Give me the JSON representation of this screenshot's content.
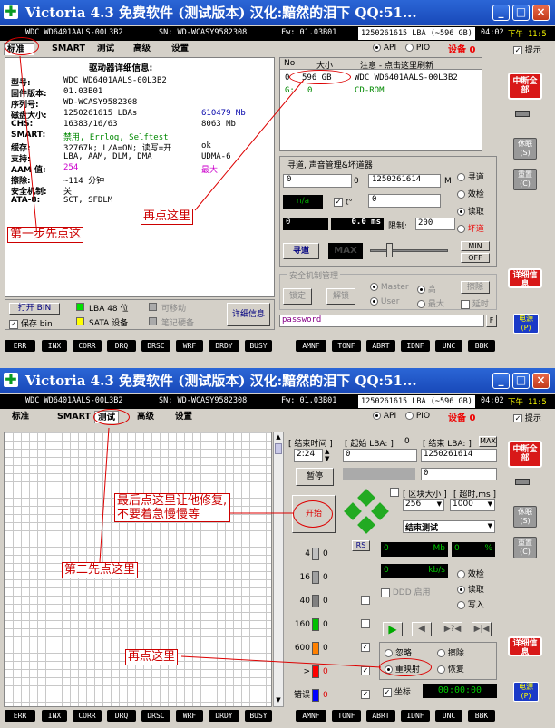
{
  "top": {
    "title": "Victoria 4.3 免费软件 (测试版本) 汉化:黯然的泪下 QQ:51...",
    "drive": "WDC WD6401AALS-00L3B2",
    "sn": "SN: WD-WCASY9582308",
    "fw": "Fw: 01.03B01",
    "lba": "1250261615 LBA (~596 GB)",
    "time1": "04:02",
    "time2": "下午 11:5",
    "tabs": [
      "标准",
      "SMART",
      "测试",
      "高级",
      "设置"
    ],
    "api": "API",
    "pio": "PIO",
    "device_label": "设备",
    "device_num": "0",
    "hint": "提示",
    "info_title": "驱动器详细信息:",
    "info_rows": [
      {
        "label": "型号:",
        "value": "WDC WD6401AALS-00L3B2",
        "extra": ""
      },
      {
        "label": "固件版本:",
        "value": "01.03B01",
        "extra": ""
      },
      {
        "label": "序列号:",
        "value": "WD-WCASY9582308",
        "extra": ""
      },
      {
        "label": "磁盘大小:",
        "value": "1250261615 LBAs",
        "extra": "610479 Mb"
      },
      {
        "label": "CHS:",
        "value": "16383/16/63",
        "extra": "8063 Mb"
      },
      {
        "label": "SMART:",
        "value": "禁用, Errlog, Selftest",
        "extra": ""
      },
      {
        "label": "缓存:",
        "value": "32767k; L/A=ON; 读写=开",
        "extra": "ok"
      },
      {
        "label": "支持:",
        "value": "LBA, AAM, DLM, DMA",
        "extra": "UDMA-6"
      },
      {
        "label": "AAM 值:",
        "value": "254",
        "extra": "最大"
      },
      {
        "label": "擦除:",
        "value": "~114 分钟",
        "extra": ""
      },
      {
        "label": "安全机制:",
        "value": "关",
        "extra": ""
      },
      {
        "label": "ATA-8:",
        "value": "SCT, SFDLM",
        "extra": ""
      }
    ],
    "table_headers": [
      "No",
      "大小",
      "注意 - 点击这里刷新"
    ],
    "table_rows": [
      {
        "no": "0",
        "size": "596 GB",
        "note": "WDC WD6401AALS-00L3B2"
      },
      {
        "no": "G:",
        "size": "0",
        "note": "CD-ROM"
      }
    ],
    "seek_title": "寻道, 声音管理&坏道器",
    "seek_start": "0",
    "seek_zero": "0",
    "seek_end": "1250261614",
    "seek_m": "M",
    "na": "n/a",
    "t_label": "t°",
    "field_zero": "0",
    "time_zero": "0",
    "ms_value": "0.0 ms",
    "limit_label": "限制:",
    "limit_value": "200",
    "seek_radios": [
      "寻道",
      "效检",
      "读取",
      "坏道"
    ],
    "seek_button": "寻道",
    "max_label": "MAX",
    "min_label": "MIN",
    "off_label": "OFF",
    "security_title": "安全机制管理",
    "lock": "锁定",
    "unlock": "解锁",
    "master": "Master",
    "user": "User",
    "high": "高",
    "max_radio": "最大",
    "erase": "擦除",
    "erase2": "延时",
    "password": "password",
    "f_label": "F",
    "open_bin": "打开 BIN",
    "save_bin": "保存 bin",
    "lba48": "LBA 48 位",
    "sata": "SATA 设备",
    "removable": "可移动",
    "laptop": "笔记硬备",
    "detail_button": "详细信息",
    "break_all": "中断全部",
    "sleep": "休眠 (S)",
    "recal": "重置 (C)",
    "details_red": "详细信息",
    "power": "电源 (P)",
    "bottom": [
      "ERR",
      "INX",
      "CORR",
      "DRQ",
      "DRSC",
      "WRF",
      "DRDY",
      "BUSY",
      "AMNF",
      "TONF",
      "ABRT",
      "IDNF",
      "UNC",
      "BBK"
    ],
    "annot_step1": "第一步先点这",
    "annot_click": "再点这里"
  },
  "bottom_panel": {
    "title": "Victoria 4.3 免费软件 (测试版本) 汉化:黯然的泪下 QQ:51...",
    "end_time_label": "[ 结束时间 ]",
    "start_lba_label": "[ 起始 LBA: ]",
    "start_zero": "0",
    "end_lba_label": "[ 结束 LBA: ]",
    "max_label": "MAX",
    "time": "2:24",
    "start_lba": "0",
    "end_lba": "1250261614",
    "pause": "暂停",
    "start": "开始",
    "block_size_label": "[ 区块大小 ]",
    "timeout_label": "[ 超时,ms ]",
    "block_size": "256",
    "timeout": "1000",
    "end_test": "结束测试",
    "rs": "RS",
    "legend": [
      {
        "label": "4",
        "count": "0",
        "color": "#c0c0c0"
      },
      {
        "label": "16",
        "count": "0",
        "color": "#a0a0a0"
      },
      {
        "label": "40",
        "count": "0",
        "color": "#808080"
      },
      {
        "label": "160",
        "count": "0",
        "color": "#00c000"
      },
      {
        "label": "600",
        "count": "0",
        "color": "#ff8000"
      },
      {
        "label": ">",
        "count": "0",
        "color": "#ff0000"
      },
      {
        "label": "错误",
        "count": "0",
        "color": "#0000ff"
      }
    ],
    "mb": "Mb",
    "zero_mb": "0",
    "zero_pct": "0",
    "pct": "%",
    "zero_kbs": "0",
    "kbs": "kb/s",
    "ddd": "DDD 启用",
    "radios": [
      "效检",
      "读取",
      "写入"
    ],
    "actions": [
      "忽略",
      "擦除",
      "重映射",
      "恢复"
    ],
    "coord": "坐标",
    "timer": "00:00:00",
    "annot_last": "最后点这里让他修复,不要着急慢慢等",
    "annot_second": "第二先点这里",
    "annot_again": "再点这里"
  }
}
